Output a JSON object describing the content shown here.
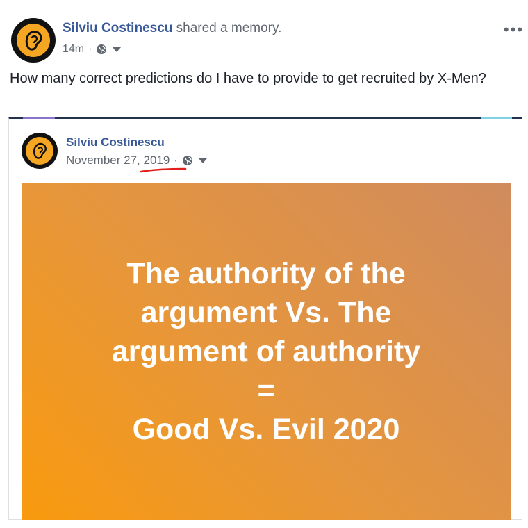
{
  "post": {
    "author": "Silviu Costinescu",
    "action": "shared a memory.",
    "time": "14m",
    "separator": "·",
    "text": "How many correct predictions do I have to provide to get recruited by X-Men?",
    "more": "•••"
  },
  "memory": {
    "author": "Silviu Costinescu",
    "date": "November 27, 2019",
    "separator": "·",
    "image_lines": [
      "The authority of the",
      "argument Vs. The",
      "argument of authority",
      "=",
      "Good Vs. Evil 2020"
    ]
  },
  "colors": {
    "link": "#385898",
    "meta": "#616770",
    "image_gradient_start": "#f99a0e",
    "image_gradient_end": "#d08b5e",
    "avatar_ring": "#111111",
    "avatar_fill": "#f5a623",
    "annotation_underline": "#e0201c"
  },
  "icons": {
    "privacy": "globe-icon",
    "audience_menu": "caret-down-icon",
    "options": "more-horizontal-icon"
  }
}
